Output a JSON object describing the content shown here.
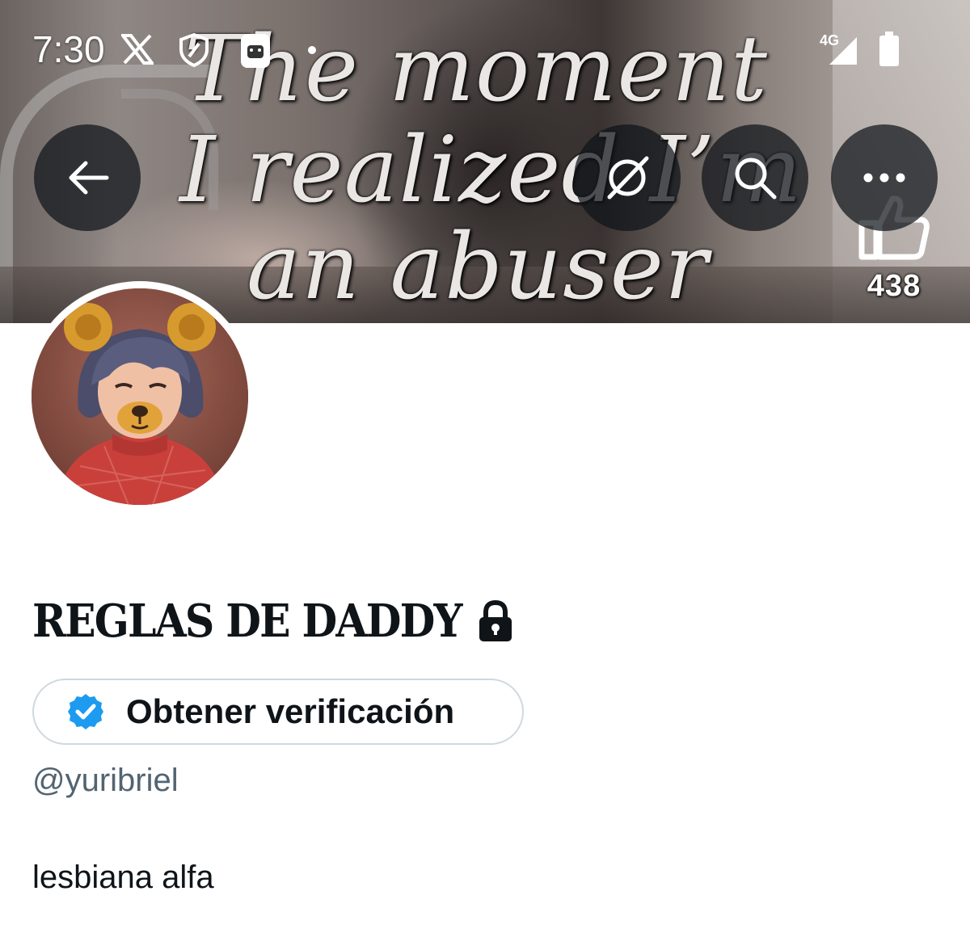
{
  "status_bar": {
    "time": "7:30",
    "network": "4G",
    "icons": [
      "x-logo-icon",
      "shield-icon",
      "android-notification-icon",
      "dot-icon",
      "signal-icon",
      "battery-icon"
    ]
  },
  "banner": {
    "overlay_lines": [
      "The moment",
      "I realized I’m",
      "an abuser"
    ],
    "like_count": "438"
  },
  "header_buttons": [
    "back-arrow-icon",
    "grok-icon",
    "search-icon",
    "more-icon"
  ],
  "profile": {
    "display_name": "REGLAS DE DADDY",
    "verify_label": "Obtener verificación",
    "handle": "@yuribriel",
    "bio": "lesbiana alfa"
  },
  "colors": {
    "text": "#0f1419",
    "secondary": "#536471",
    "verify_blue": "#1d9bf0",
    "border": "#cfd9de"
  }
}
